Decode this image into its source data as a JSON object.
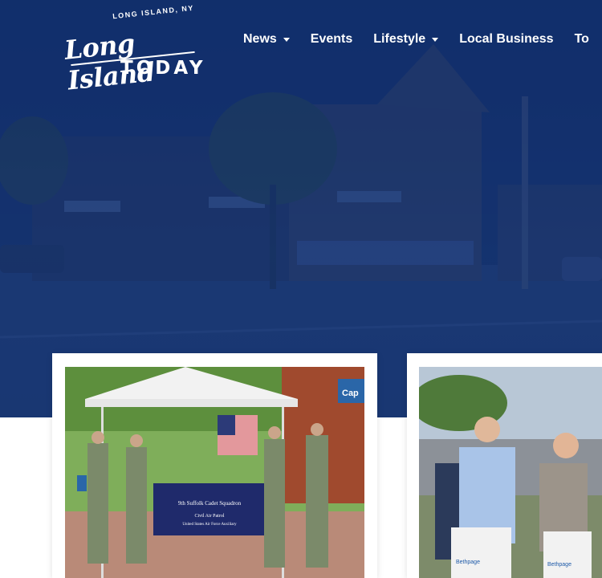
{
  "logo": {
    "tagline": "LONG ISLAND, NY",
    "main": "Long Island",
    "sub": "TODAY"
  },
  "nav": {
    "items": [
      {
        "label": "News",
        "has_dropdown": true
      },
      {
        "label": "Events",
        "has_dropdown": false
      },
      {
        "label": "Lifestyle",
        "has_dropdown": true
      },
      {
        "label": "Local Business",
        "has_dropdown": false
      },
      {
        "label": "To",
        "has_dropdown": false
      }
    ]
  },
  "cards": [
    {
      "banner_line1": "9th Suffolk Cadet Squadron",
      "banner_line2": "Civil Air Patrol",
      "banner_line3": "United States Air Force Auxiliary",
      "sign_text": "Cap"
    },
    {
      "bike_brand": "Bethpage"
    }
  ],
  "colors": {
    "hero_blue": "#132f6b",
    "nav_text": "#ffffff",
    "banner_navy": "#1f2a6b"
  }
}
